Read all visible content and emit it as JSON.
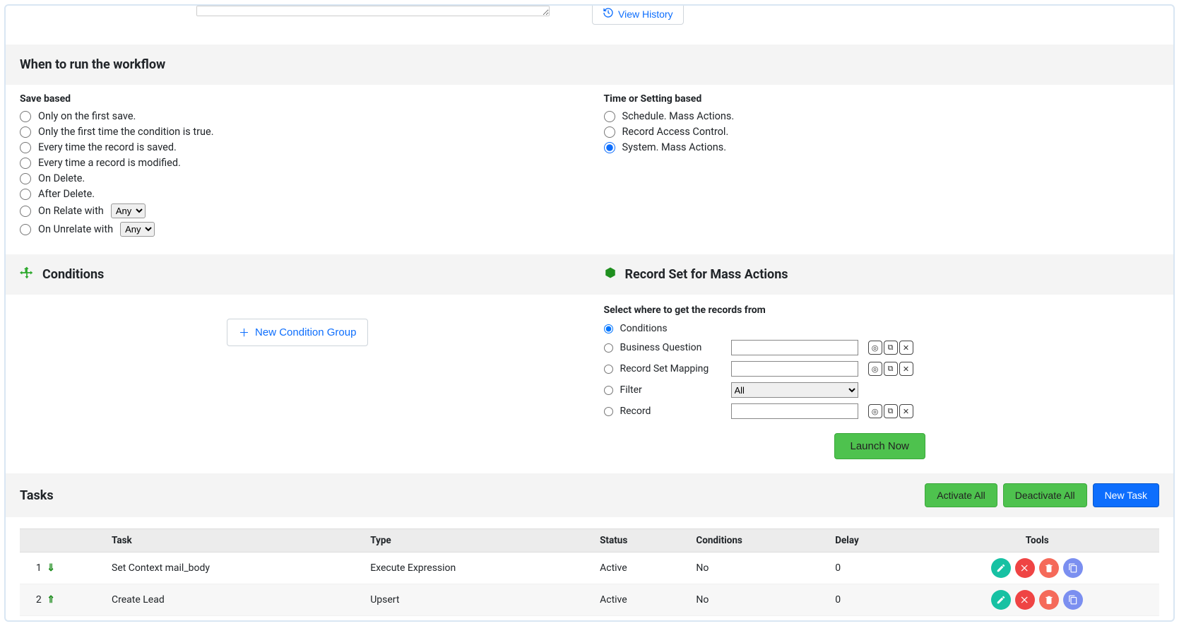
{
  "top": {
    "view_history": "View History"
  },
  "when": {
    "heading": "When to run the workflow",
    "save_based": "Save based",
    "time_based": "Time or Setting based",
    "opts": {
      "s1": "Only on the first save.",
      "s2": "Only the first time the condition is true.",
      "s3": "Every time the record is saved.",
      "s4": "Every time a record is modified.",
      "s5": "On Delete.",
      "s6": "After Delete.",
      "s7a": "On Relate with",
      "s7sel": "Any",
      "s8a": "On Unrelate with",
      "s8sel": "Any",
      "t1": "Schedule. Mass Actions.",
      "t2": "Record Access Control.",
      "t3": "System. Mass Actions."
    }
  },
  "conditions": {
    "heading": "Conditions",
    "new_group": "New Condition Group"
  },
  "recordset": {
    "heading": "Record Set for Mass Actions",
    "select_label": "Select where to get the records from",
    "opts": {
      "r1": "Conditions",
      "r2": "Business Question",
      "r3": "Record Set Mapping",
      "r4": "Filter",
      "r4sel": "All",
      "r5": "Record"
    },
    "launch": "Launch Now"
  },
  "tasks": {
    "heading": "Tasks",
    "activate_all": "Activate All",
    "deactivate_all": "Deactivate All",
    "new_task": "New Task",
    "cols": {
      "task": "Task",
      "type": "Type",
      "status": "Status",
      "conditions": "Conditions",
      "delay": "Delay",
      "tools": "Tools"
    },
    "rows": [
      {
        "order": "1",
        "name": "Set Context mail_body",
        "type": "Execute Expression",
        "status": "Active",
        "conditions": "No",
        "delay": "0"
      },
      {
        "order": "2",
        "name": "Create Lead",
        "type": "Upsert",
        "status": "Active",
        "conditions": "No",
        "delay": "0"
      }
    ]
  }
}
